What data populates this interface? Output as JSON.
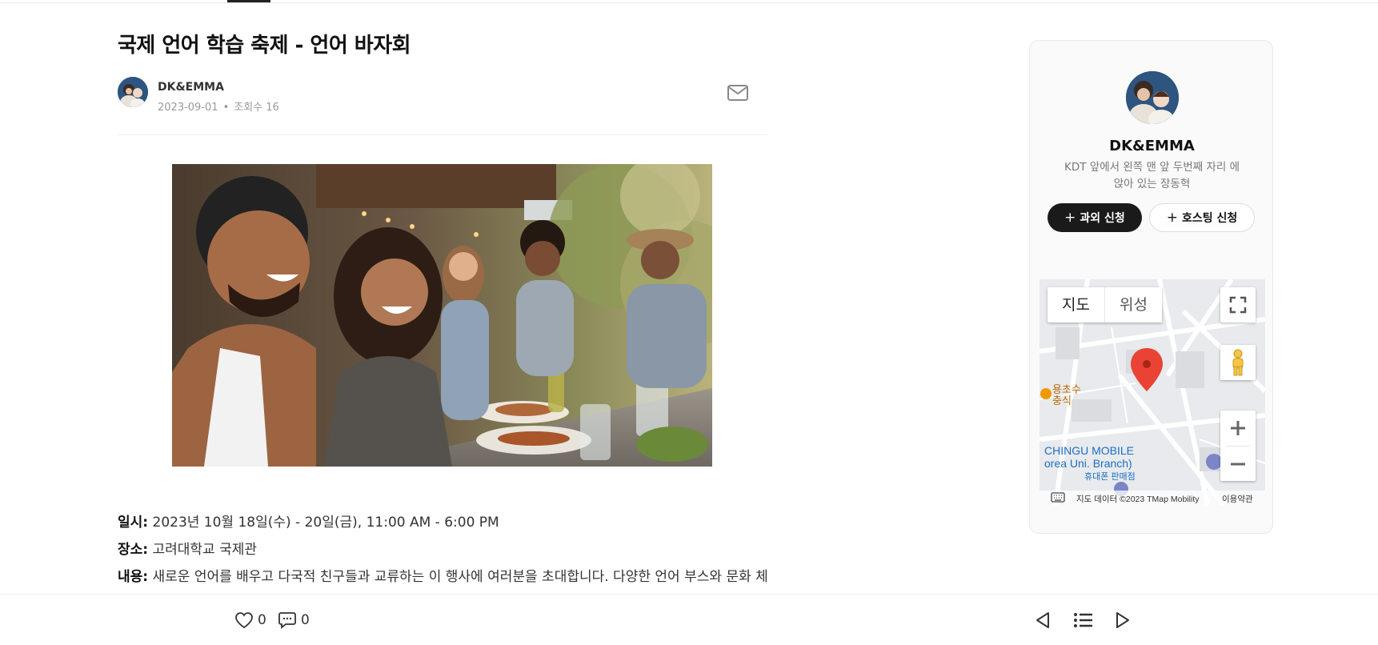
{
  "post": {
    "title": "국제 언어 학습 축제 - 언어 바자회",
    "author": "DK&EMMA",
    "date": "2023-09-01",
    "views": "조회수 16",
    "details": {
      "date_label": "일시:",
      "date_value": " 2023년 10월 18일(수) - 20일(금), 11:00 AM - 6:00 PM",
      "place_label": "장소:",
      "place_value": " 고려대학교 국제관",
      "content_label": "내용:",
      "content_value": " 새로운 언어를 배우고 다국적 친구들과 교류하는 이 행사에 여러분을 초대합니다. 다양한 언어 부스와 문화 체험"
    }
  },
  "profile": {
    "name": "DK&EMMA",
    "description": "KDT 앞에서 왼쪽 맨 앞 두번째 자리 에 앉아 있는 장동혁",
    "tutor_button": "과외 신청",
    "host_button": "호스팅 신청"
  },
  "map": {
    "type_map": "지도",
    "type_satellite": "위성",
    "label_chingu_line1": "CHINGU MOBILE",
    "label_chingu_line2": "orea Uni. Branch)",
    "label_shop": "휴대폰 판매점",
    "label_cho_line1": "용초수",
    "label_cho_line2": "충식",
    "attribution": "지도 데이터 ©2023 TMap Mobility",
    "terms": "이용약관"
  },
  "bottom": {
    "likes": "0",
    "comments": "0"
  },
  "colors": {
    "accent_dark": "#1a1a1a",
    "map_pin": "#ea4335",
    "map_label_blue": "#1a6fc4"
  },
  "icons": [
    "mail-icon",
    "heart-icon",
    "comment-icon",
    "prev-icon",
    "list-icon",
    "next-icon",
    "fullscreen-icon",
    "pegman-icon",
    "zoom-in-icon",
    "zoom-out-icon",
    "map-pin-icon",
    "keyboard-icon"
  ]
}
